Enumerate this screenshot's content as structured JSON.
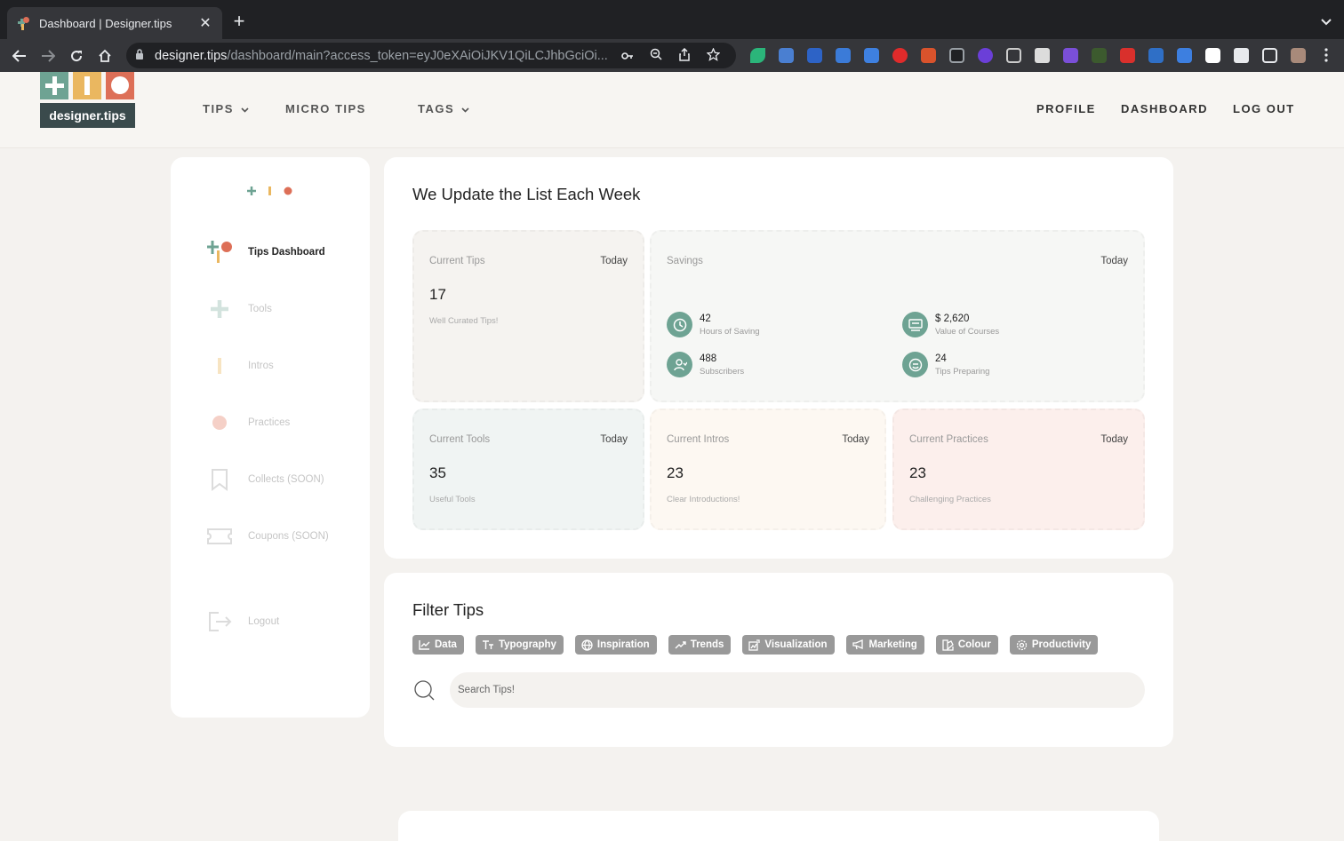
{
  "browser": {
    "tab_title": "Dashboard | Designer.tips",
    "url_domain": "designer.tips",
    "url_path": "/dashboard/main?access_token=eyJ0eXAiOiJKV1QiLCJhbGciOi..."
  },
  "site": {
    "logo_text": "designer.tips",
    "nav_left": [
      {
        "label": "TIPS",
        "dropdown": true
      },
      {
        "label": "MICRO TIPS",
        "dropdown": false
      },
      {
        "label": "TAGS",
        "dropdown": true
      }
    ],
    "nav_right": [
      "PROFILE",
      "DASHBOARD",
      "LOG OUT"
    ]
  },
  "sidebar": {
    "items": [
      {
        "label": "Tips Dashboard",
        "icon": "tips-logo-icon",
        "active": true
      },
      {
        "label": "Tools",
        "icon": "plus-icon"
      },
      {
        "label": "Intros",
        "icon": "bar-icon"
      },
      {
        "label": "Practices",
        "icon": "dot-icon"
      },
      {
        "label": "Collects (SOON)",
        "icon": "bookmark-icon"
      },
      {
        "label": "Coupons (SOON)",
        "icon": "ticket-icon"
      },
      {
        "label": "Logout",
        "icon": "logout-icon"
      }
    ]
  },
  "stats_panel": {
    "title": "We Update the List Each Week",
    "current_tips": {
      "label": "Current Tips",
      "when": "Today",
      "value": "17",
      "sub": "Well Curated Tips!"
    },
    "savings": {
      "label": "Savings",
      "when": "Today",
      "items": [
        {
          "value": "42",
          "label": "Hours of Saving",
          "icon": "clock-icon"
        },
        {
          "value": "$ 2,620",
          "label": "Value of Courses",
          "icon": "course-icon"
        },
        {
          "value": "488",
          "label": "Subscribers",
          "icon": "user-icon"
        },
        {
          "value": "24",
          "label": "Tips Preparing",
          "icon": "preparing-icon"
        }
      ]
    },
    "current_tools": {
      "label": "Current Tools",
      "when": "Today",
      "value": "35",
      "sub": "Useful Tools"
    },
    "current_intros": {
      "label": "Current Intros",
      "when": "Today",
      "value": "23",
      "sub": "Clear Introductions!"
    },
    "current_practices": {
      "label": "Current Practices",
      "when": "Today",
      "value": "23",
      "sub": "Challenging Practices"
    }
  },
  "filter_panel": {
    "title": "Filter Tips",
    "tags": [
      {
        "label": "Data",
        "icon": "chart-icon"
      },
      {
        "label": "Typography",
        "icon": "typography-icon"
      },
      {
        "label": "Inspiration",
        "icon": "globe-icon"
      },
      {
        "label": "Trends",
        "icon": "trend-icon"
      },
      {
        "label": "Visualization",
        "icon": "visualization-icon"
      },
      {
        "label": "Marketing",
        "icon": "megaphone-icon"
      },
      {
        "label": "Colour",
        "icon": "palette-icon"
      },
      {
        "label": "Productivity",
        "icon": "gear-icon"
      }
    ],
    "search_placeholder": "Search Tips!"
  },
  "colors": {
    "green": "#6ea393",
    "yellow": "#eab760",
    "red": "#dd6f57",
    "tag_gray": "#999999"
  }
}
